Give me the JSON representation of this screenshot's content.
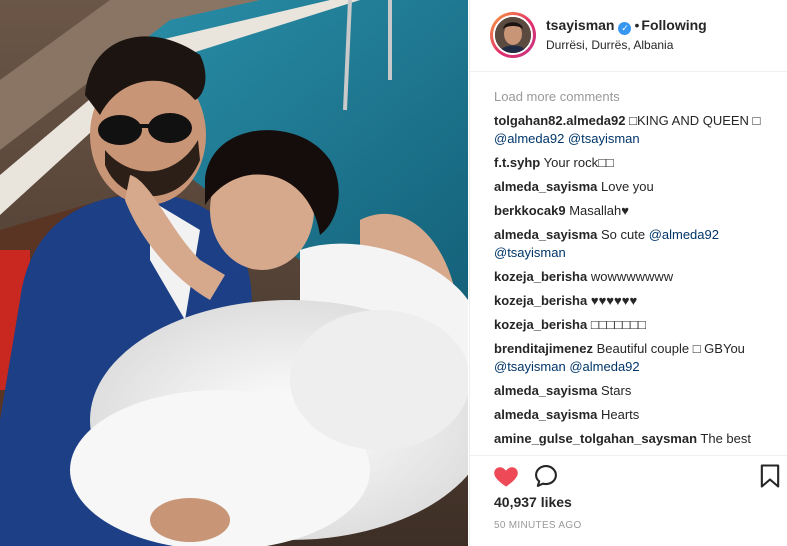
{
  "post": {
    "username": "tsayisman",
    "verified_glyph": "✓",
    "separator": "•",
    "follow_state": "Following",
    "location": "Durrësi, Durrës, Albania"
  },
  "comments_section": {
    "load_more": "Load more comments",
    "items": [
      {
        "user": "tolgahan82.almeda92",
        "parts": [
          "□KING AND QUEEN □ ",
          "@almeda92",
          " ",
          "@tsayisman"
        ]
      },
      {
        "user": "f.t.syhp",
        "parts": [
          "Your rock□□"
        ]
      },
      {
        "user": "almeda_sayisma",
        "parts": [
          "Love you"
        ]
      },
      {
        "user": "berkkocak9",
        "parts": [
          "Masallah♥"
        ]
      },
      {
        "user": "almeda_sayisma",
        "parts": [
          "So cute ",
          "@almeda92",
          " ",
          "@tsayisman"
        ]
      },
      {
        "user": "kozeja_berisha",
        "parts": [
          "wowwwwwww"
        ]
      },
      {
        "user": "kozeja_berisha",
        "parts": [
          "♥♥♥♥♥♥"
        ]
      },
      {
        "user": "kozeja_berisha",
        "parts": [
          "□□□□□□□"
        ]
      },
      {
        "user": "brenditajimenez",
        "parts": [
          "Beautiful couple □ GBYou ",
          "@tsayisman",
          " ",
          "@almeda92"
        ]
      },
      {
        "user": "almeda_sayisma",
        "parts": [
          "Stars"
        ]
      },
      {
        "user": "almeda_sayisma",
        "parts": [
          "Hearts"
        ]
      },
      {
        "user": "amine_gulse_tolgahan_saysman",
        "parts": [
          "The best"
        ]
      }
    ]
  },
  "actions": {
    "like_icon": "heart-filled",
    "comment_icon": "speech-bubble",
    "save_icon": "bookmark",
    "like_color": "#ed4956"
  },
  "stats": {
    "likes": "40,937 likes",
    "time": "50 MINUTES AGO"
  },
  "colors": {
    "mention": "#003569",
    "muted": "#999999",
    "verified": "#3897f0"
  }
}
